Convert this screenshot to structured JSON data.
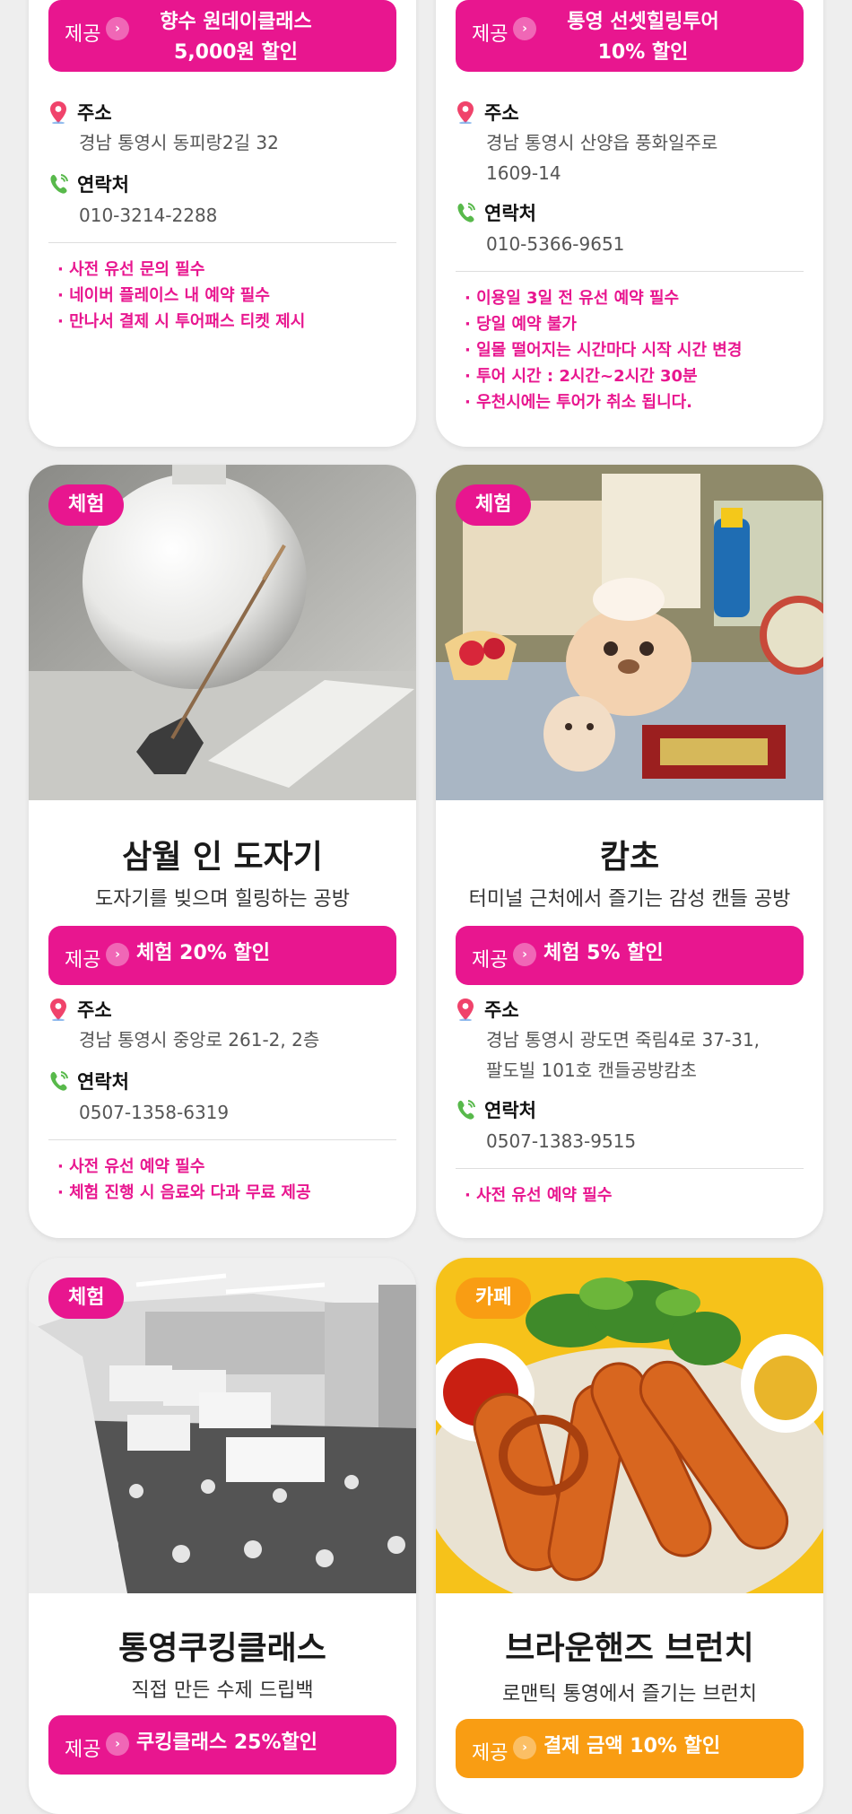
{
  "colors": {
    "pink": "#e8168f",
    "orange": "#f99d13",
    "bg": "#eeeeee"
  },
  "offer_label": "제공",
  "address_label": "주소",
  "contact_label": "연락처",
  "cards": [
    {
      "offer": "향수 원데이클래스\n5,000원 할인",
      "address": "경남 통영시 동피랑2길 32",
      "phone": "010-3214-2288",
      "notes": [
        "· 사전 유선 문의 필수",
        "· 네이버 플레이스 내 예약 필수",
        "· 만나서 결제 시 투어패스 티켓 제시"
      ]
    },
    {
      "offer": "통영 선셋힐링투어\n10% 할인",
      "address": "경남 통영시 산양읍 풍화일주로\n1609-14",
      "phone": "010-5366-9651",
      "notes": [
        "· 이용일 3일 전 유선 예약 필수",
        "· 당일 예약 불가",
        "· 일몰 떨어지는 시간마다 시작 시간 변경",
        "· 투어 시간 : 2시간~2시간 30분",
        "· 우천시에는 투어가 취소 됩니다."
      ]
    },
    {
      "category": "체험",
      "title": "삼월 인 도자기",
      "subtitle": "도자기를 빚으며 힐링하는 공방",
      "offer": "체험 20% 할인",
      "address": "경남 통영시 중앙로 261-2, 2층",
      "phone": "0507-1358-6319",
      "notes": [
        "· 사전 유선 예약 필수",
        "· 체험 진행 시 음료와 다과 무료 제공"
      ]
    },
    {
      "category": "체험",
      "title": "캄초",
      "subtitle": "터미널 근처에서 즐기는 감성 캔들 공방",
      "offer": "체험 5% 할인",
      "address": "경남 통영시 광도면 죽림4로 37-31,\n팔도빌 101호 캔들공방캄초",
      "phone": "0507-1383-9515",
      "notes": [
        "· 사전 유선 예약 필수"
      ]
    },
    {
      "category": "체험",
      "title": "통영쿠킹클래스",
      "subtitle": "직접 만든 수제 드립백",
      "offer": "쿠킹클래스 25%할인"
    },
    {
      "category": "카페",
      "title": "브라운핸즈 브런치",
      "subtitle": "로맨틱 통영에서 즐기는 브런치",
      "offer": "결제 금액 10% 할인"
    }
  ]
}
